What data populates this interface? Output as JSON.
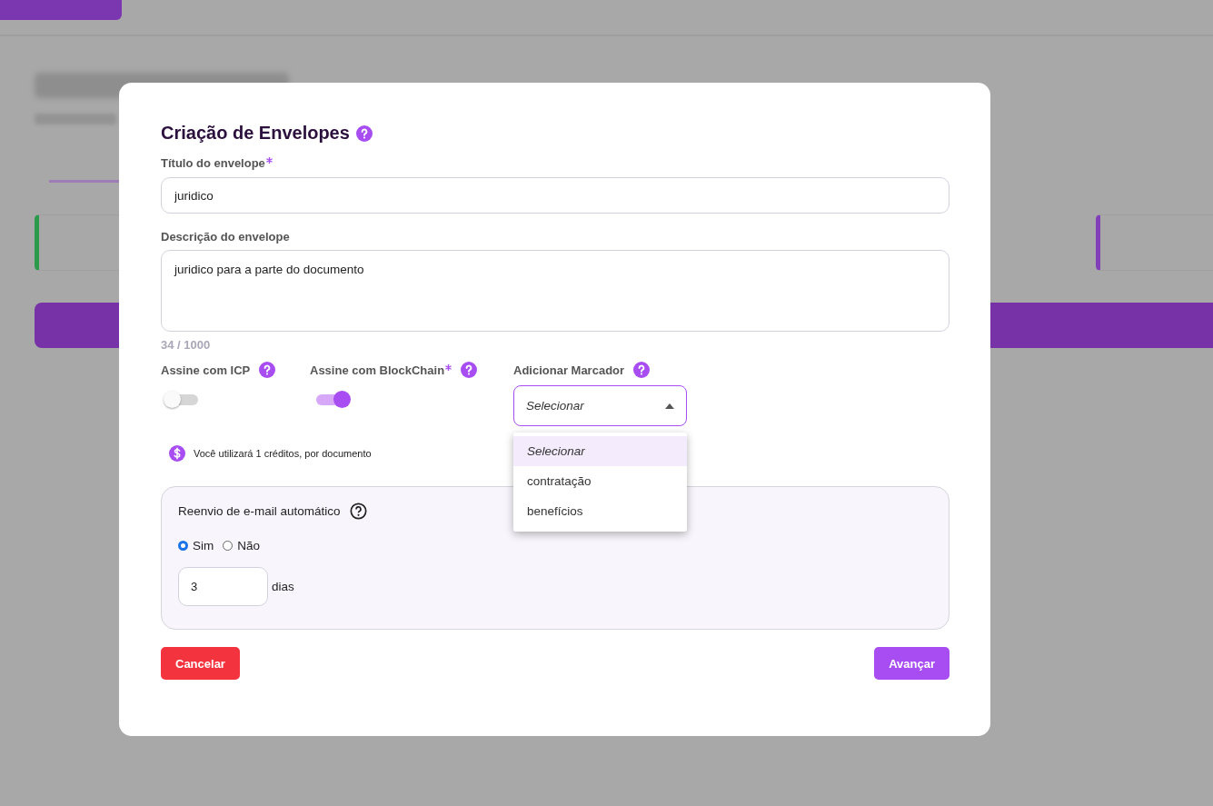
{
  "modal": {
    "title": "Criação de Envelopes",
    "title_field": {
      "label": "Título do envelope",
      "required": true,
      "value": "juridico"
    },
    "description_field": {
      "label": "Descrição do envelope",
      "value": "juridico para a parte do documento",
      "counter": "34 / 1000"
    },
    "toggles": [
      {
        "label": "Assine com ICP",
        "required": false,
        "on": false
      },
      {
        "label": "Assine com BlockChain",
        "required": true,
        "on": true
      }
    ],
    "marker": {
      "label": "Adicionar Marcador",
      "value": "Selecionar",
      "expanded": true,
      "options": [
        {
          "label": "Selecionar",
          "selected": true
        },
        {
          "label": "contratação",
          "selected": false
        },
        {
          "label": "benefícios",
          "selected": false
        }
      ]
    },
    "credits_note": "Você utilizará 1 créditos, por documento",
    "resend": {
      "label": "Reenvio de e-mail automático",
      "options": [
        {
          "label": "Sim",
          "selected": true
        },
        {
          "label": "Não",
          "selected": false
        }
      ],
      "days_value": "3",
      "days_unit": "dias"
    },
    "buttons": [
      {
        "label": "Cancelar",
        "kind": "danger"
      },
      {
        "label": "Avançar",
        "kind": "primary"
      }
    ]
  }
}
